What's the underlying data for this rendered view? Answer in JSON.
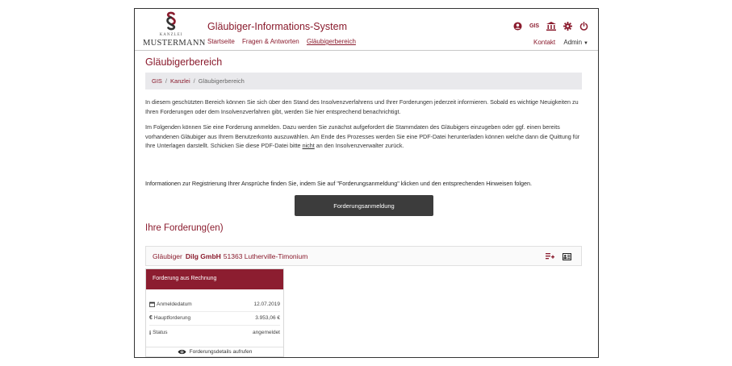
{
  "logo": {
    "small_text": "KANZLEI",
    "big_text": "MUSTERMANN"
  },
  "header": {
    "app_title": "Gläubiger-Informations-System",
    "nav": {
      "home": "Startseite",
      "faq": "Fragen & Antworten",
      "creditor_area": "Gläubigerbereich"
    },
    "icons": {
      "language": "german-flag-icon",
      "user": "user-circle-icon",
      "gis": "GIS",
      "bank": "bank-icon",
      "settings": "gear-icon",
      "power": "power-icon"
    },
    "contact": "Kontakt",
    "admin": "Admin"
  },
  "page": {
    "title": "Gläubigerbereich",
    "breadcrumb": [
      "GIS",
      "Kanzlei",
      "Gläubigerbereich"
    ],
    "para1": "In diesem geschützten Bereich können Sie sich über den Stand des Insolvenzverfahrens und Ihrer Forderungen jederzeit informieren. Sobald es wichtige Neuigkeiten zu Ihren Forderungen oder dem Insolvenzverfahren gibt, werden Sie hier entsprechend benachrichtigt.",
    "para2_a": "Im Folgenden können Sie eine Forderung anmelden. Dazu werden Sie zunächst aufgefordert die Stammdaten des Gläubigers einzugeben oder ggf. einen bereits vorhandenen Gläubiger aus Ihrem Benutzerkonto auszuwählen. Am Ende des Prozesses werden Sie eine PDF-Datei herunterladen können welche dann die Quittung für Ihre Unterlagen darstellt. Schicken Sie diese PDF-Datei bitte",
    "para2_underlined": "nicht",
    "para2_b": "an den Insolvenzverwalter zurück.",
    "info_line": "Informationen zur Registrierung Ihrer Ansprüche finden Sie, indem Sie auf \"Forderungsanmeldung\" klicken und den entsprechenden Hinweisen folgen.",
    "claim_button": "Forderungsanmeldung",
    "claims_title": "Ihre Forderung(en)"
  },
  "creditor": {
    "label": "Gläubiger",
    "name": "Dilg GmbH",
    "address": "51363 Lutherville-Timonium",
    "icons": [
      "playlist-add-icon",
      "contact-card-icon"
    ]
  },
  "claim_card": {
    "header": "Forderung aus Rechnung",
    "rows": [
      {
        "icon": "calendar-icon",
        "label": "Anmeldedatum",
        "value": "12.07.2019"
      },
      {
        "icon": "euro-icon",
        "label": "Hauptforderung",
        "value": "3.953,06 €"
      },
      {
        "icon": "info-icon",
        "label": "Status",
        "value": "angemeldet"
      }
    ],
    "footer": "Forderungsdetails aufrufen"
  },
  "colors": {
    "brand": "#8a1b2d",
    "card_header": "#8c1d30",
    "button": "#3c3c3c",
    "breadcrumb_bg": "#e9e9ec"
  }
}
